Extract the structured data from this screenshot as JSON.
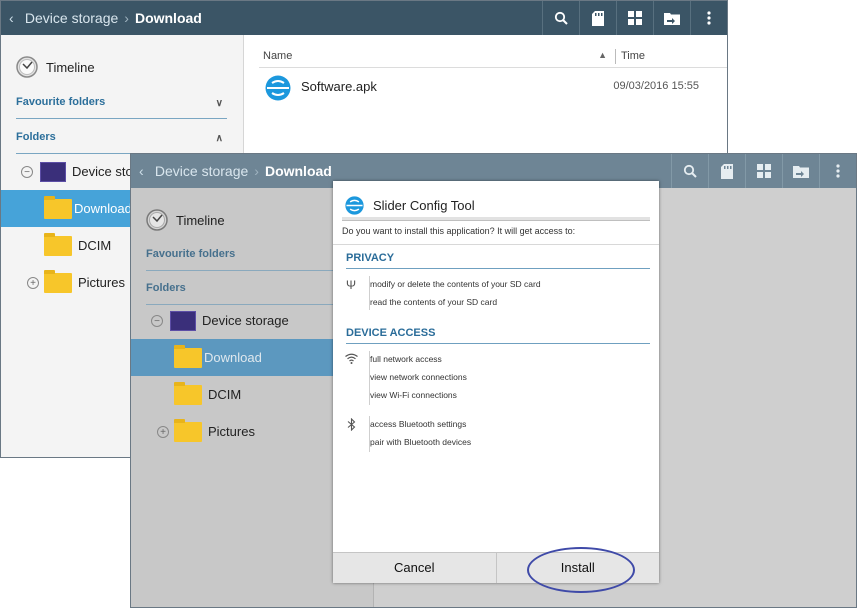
{
  "back_window": {
    "breadcrumb": {
      "root": "Device storage",
      "current": "Download"
    },
    "sidebar": {
      "timeline": "Timeline",
      "favourites": "Favourite folders",
      "folders": "Folders",
      "tree": {
        "device": "Device stor",
        "download": "Download",
        "dcim": "DCIM",
        "pictures": "Pictures"
      }
    },
    "list": {
      "col_name": "Name",
      "col_time": "Time",
      "files": [
        {
          "name": "Software.apk",
          "time": "09/03/2016 15:55"
        }
      ]
    }
  },
  "front_window": {
    "breadcrumb": {
      "root": "Device storage",
      "current": "Download"
    },
    "sidebar": {
      "timeline": "Timeline",
      "favourites": "Favourite folders",
      "folders": "Folders",
      "tree": {
        "device": "Device storage",
        "download": "Download",
        "dcim": "DCIM",
        "pictures": "Pictures"
      }
    }
  },
  "dialog": {
    "title": "Slider Config Tool",
    "question": "Do you want to install this application? It will get access to:",
    "privacy_heading": "PRIVACY",
    "privacy_items": [
      "modify or delete the contents of your SD card",
      "read the contents of your SD card"
    ],
    "device_heading": "DEVICE ACCESS",
    "network_items": [
      "full network access",
      "view network connections",
      "view Wi-Fi connections"
    ],
    "bluetooth_items": [
      "access Bluetooth settings",
      "pair with Bluetooth devices"
    ],
    "cancel": "Cancel",
    "install": "Install"
  },
  "colors": {
    "topbar": "#3b5566",
    "selection": "#46a3d9",
    "accent_text": "#2c6f9b",
    "highlight_circle": "#3f4aa8"
  },
  "icons": [
    "chevron-left-icon",
    "search-icon",
    "sd-card-icon",
    "grid-view-icon",
    "folder-move-icon",
    "overflow-menu-icon",
    "clock-icon",
    "apk-icon",
    "usb-icon",
    "wifi-icon",
    "bluetooth-icon"
  ]
}
